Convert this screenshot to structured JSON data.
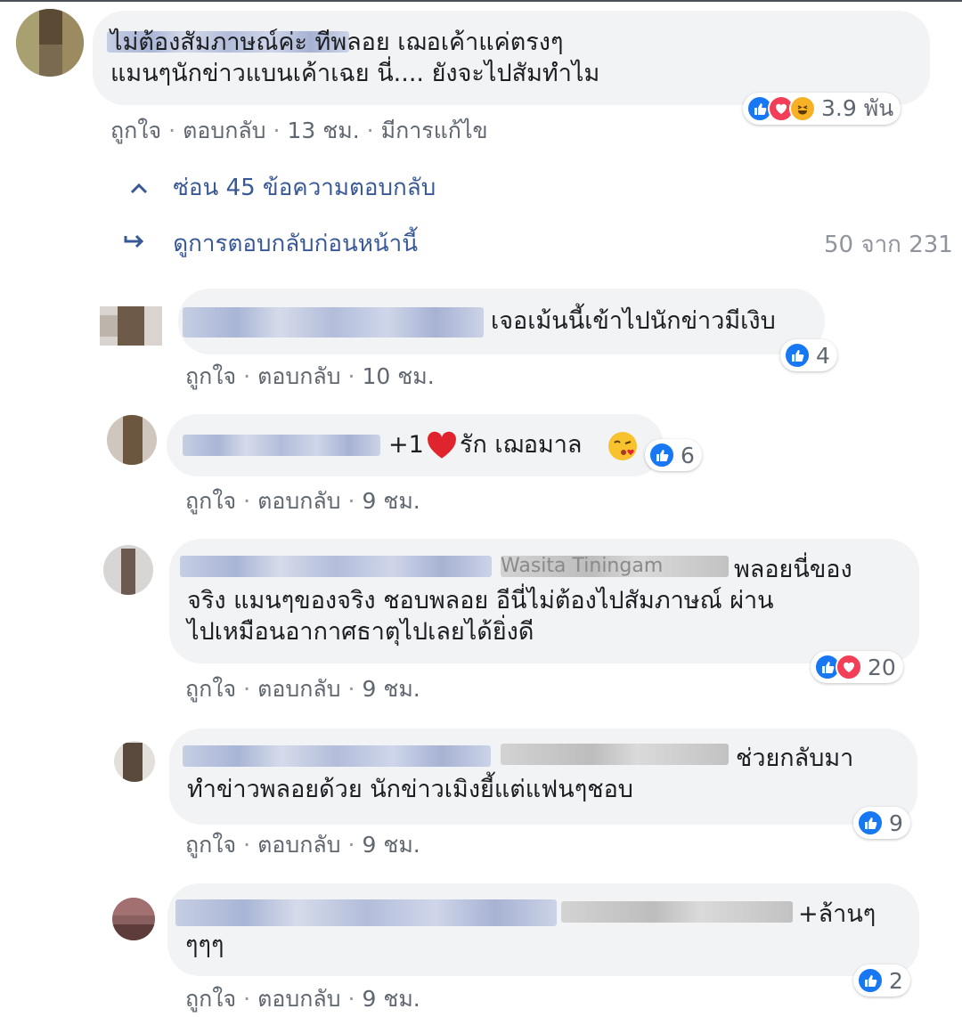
{
  "comments": [
    {
      "text": "ไม่ต้องสัมภาษณ์ค่ะ ทีพลอย เฌอเค้าแค่ตรงๆ\nแมนๆนักข่าวแบนเค้าเฉย นี่.... ยังจะไปสัมทำไม",
      "reaction_count": "3.9 พัน",
      "reactions": [
        "like-icon",
        "love-icon",
        "haha-icon"
      ],
      "actions": {
        "like": "ถูกใจ",
        "reply": "ตอบกลับ",
        "time": "13 ชม.",
        "edited": "มีการแก้ไข"
      }
    }
  ],
  "thread": {
    "hide_label": "ซ่อน 45 ข้อความตอบกลับ",
    "previous_label": "ดูการตอบกลับก่อนหน้านี้",
    "count": "50 จาก 231"
  },
  "replies": [
    {
      "text": "เจอเม้นนี้เข้าไปนักข่าวมีเงิบ",
      "reaction_count": "4",
      "like": "ถูกใจ",
      "reply": "ตอบกลับ",
      "time": "10 ชม."
    },
    {
      "text_a": "+1",
      "text_b": "รัก เฌอมาล",
      "reaction_count": "6",
      "like": "ถูกใจ",
      "reply": "ตอบกลับ",
      "time": "9 ชม."
    },
    {
      "tagged": "Wasita Tiningam",
      "text": "พลอยนี่ของ\nจริง แมนๆของจริง ชอบพลอย อีนี่ไม่ต้องไปสัมภาษณ์ ผ่าน\nไปเหมือนอากาศธาตุไปเลยได้ยิ่งดี",
      "reaction_count": "20",
      "like": "ถูกใจ",
      "reply": "ตอบกลับ",
      "time": "9 ชม."
    },
    {
      "text": "ช่วยกลับมา\nทำข่าวพลอยด้วย นักข่าวเมิงยี้แต่แฟนๆชอบ",
      "reaction_count": "9",
      "like": "ถูกใจ",
      "reply": "ตอบกลับ",
      "time": "9 ชม."
    },
    {
      "text": "+ล้านๆ\nๆๆๆ",
      "reaction_count": "2",
      "like": "ถูกใจ",
      "reply": "ตอบกลับ",
      "time": "9 ชม."
    }
  ],
  "colors": {
    "accent": "#1877f2",
    "love": "#f33e58",
    "haha": "#f7b125",
    "bubble": "#f2f3f5"
  }
}
